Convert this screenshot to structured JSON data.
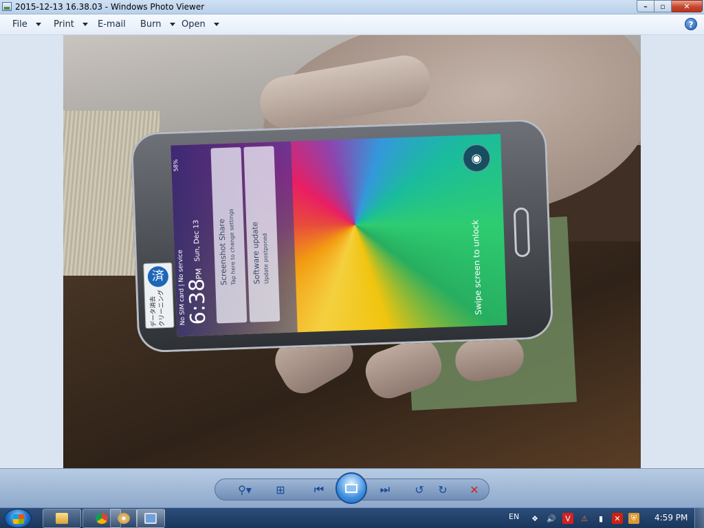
{
  "window": {
    "title": "2015-12-13 16.38.03 - Windows Photo Viewer",
    "minimize_icon": "minimize-icon",
    "maximize_icon": "maximize-icon",
    "close_icon": "close-icon"
  },
  "menu": {
    "file": "File",
    "print": "Print",
    "email": "E-mail",
    "burn": "Burn",
    "open": "Open",
    "help_icon": "help-icon"
  },
  "photo": {
    "phone": {
      "sim_status": "No SIM card | No service",
      "time": "6:38",
      "ampm": "PM",
      "date": "Sun, Dec 13",
      "status_battery": "58%",
      "notification_1_title": "Screenshot Share",
      "notification_1_sub": "Tap here to change settings",
      "notification_2_title": "Software update",
      "notification_2_sub": "Update postponed",
      "unlock_hint": "Swipe screen to unlock",
      "sticker_line1": "データ消去",
      "sticker_line2": "クリーニング",
      "sticker_kanji": "済"
    }
  },
  "controls": {
    "zoom_icon": "zoom-icon",
    "fit_icon": "actual-size-icon",
    "prev_icon": "previous-icon",
    "slideshow_icon": "slideshow-icon",
    "next_icon": "next-icon",
    "rotate_ccw_icon": "rotate-counterclockwise-icon",
    "rotate_cw_icon": "rotate-clockwise-icon",
    "delete_icon": "delete-icon"
  },
  "taskbar": {
    "language": "EN",
    "clock": "4:59 PM",
    "apps": [
      "file-explorer-icon",
      "chrome-icon",
      "paint-icon",
      "photo-viewer-icon"
    ]
  },
  "colors": {
    "accent": "#1d59ad",
    "close_red": "#c8462c",
    "taskbar": "#19365c"
  }
}
